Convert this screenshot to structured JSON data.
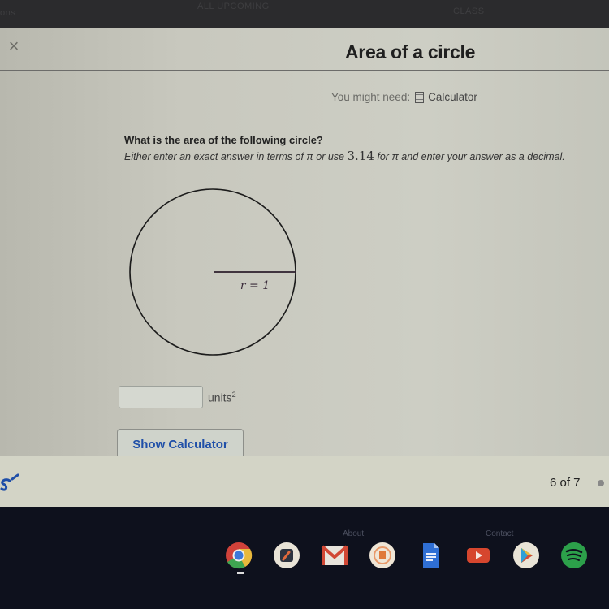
{
  "top_bar": {
    "left_tab": "ons",
    "tab_a": "ALL UPCOMING",
    "tab_b": "CLASS"
  },
  "exercise": {
    "title": "Area of a circle",
    "close_icon": "close-icon",
    "might_need_label": "You might need:",
    "calculator_label": "Calculator"
  },
  "question": {
    "prompt": "What is the area of the following circle?",
    "instruction_part1": "Either enter an exact answer in terms of ",
    "pi": "π",
    "instruction_part2": " or use ",
    "pi_value": "3.14",
    "instruction_part3": " for ",
    "instruction_part4": " and enter your answer as a decimal."
  },
  "figure": {
    "radius_label": "r = 1",
    "radius_value": 1
  },
  "answer": {
    "value": "",
    "placeholder": "",
    "units_label": "units",
    "units_exponent": "2"
  },
  "buttons": {
    "show_calculator": "Show Calculator"
  },
  "footer": {
    "progress_text": "6 of 7",
    "current": 6,
    "total": 7
  },
  "below_links": {
    "about": "About",
    "contact": "Contact"
  },
  "shelf": {
    "apps": [
      "Chrome",
      "Photo Editor",
      "Gmail",
      "Keep",
      "Docs",
      "YouTube",
      "Play Store",
      "Spotify"
    ]
  },
  "colors": {
    "accent_blue": "#1f4fa8",
    "page_bg": "#c9c9c0",
    "shelf_bg": "#0e111d"
  }
}
